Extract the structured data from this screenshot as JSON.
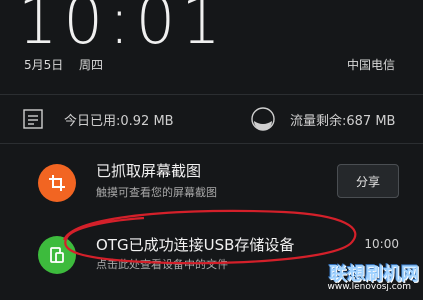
{
  "lockscreen": {
    "time": "10:01",
    "date": "5月5日",
    "weekday": "周四",
    "carrier": "中国电信"
  },
  "data_usage": {
    "today_used": "今日已用:0.92 MB",
    "remaining": "流量剩余:687 MB"
  },
  "notifications": [
    {
      "title": "已抓取屏幕截图",
      "subtitle": "触摸可查看您的屏幕截图",
      "action_label": "分享",
      "icon": "crop-icon",
      "color": "#f26522"
    },
    {
      "title": "OTG已成功连接USB存储设备",
      "subtitle": "点击此处查看设备中的文件",
      "time": "10:00",
      "icon": "usb-device-icon",
      "color": "#3dbb3d"
    }
  ],
  "annotation": {
    "color": "#d4202a"
  },
  "watermark": {
    "site_name": "联想刷机网",
    "url": "www.lenovosj.com"
  }
}
